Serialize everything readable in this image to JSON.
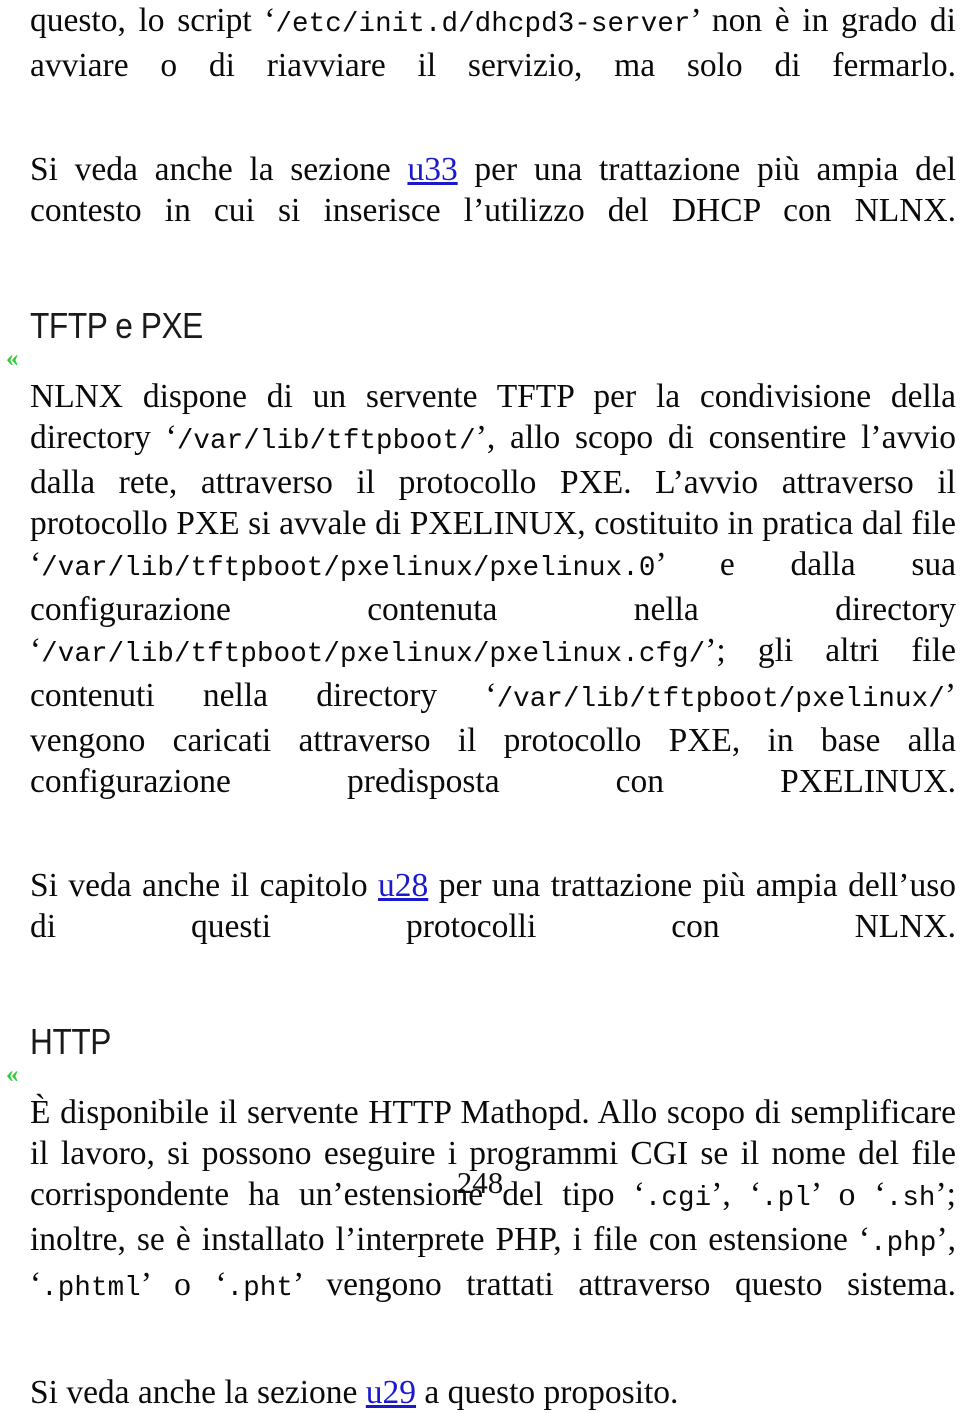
{
  "page": {
    "number": "248",
    "link_color": "#1a1acc",
    "marker_color": "#2ecc33",
    "text_color": "#0a0a0a",
    "background": "#ffffff"
  },
  "paragraphs": {
    "p1": {
      "seg1": "questo, lo script ‘",
      "mono1": "/etc/init.d/dhcpd3-server",
      "seg2": "’ non è in grado di avviare o di riavviare il servizio, ma solo di fermarlo."
    },
    "p2": {
      "seg1": "Si veda anche la sezione ",
      "link": "u33",
      "seg2": " per una trattazione più ampia del contesto in cui si inserisce l’utilizzo del DHCP con NLNX."
    }
  },
  "sections": [
    {
      "id": "tftp-pxe",
      "heading": "TFTP e PXE",
      "marker": "«",
      "body": {
        "seg1": "NLNX dispone di un servente TFTP per la condivisione della directory ‘",
        "mono1": "/var/lib/tftpboot/",
        "seg2": "’, allo scopo di consentire l’avvio dalla rete, attraverso il protocollo PXE. L’avvio attraverso il protocollo PXE si avvale di PXELINUX, costituito in pratica dal file ‘",
        "mono2": "/var/lib/tftpboot/pxelinux/pxelinux.0",
        "seg3": "’ e dalla sua configurazione contenuta nella directory ‘",
        "mono3": "/var/lib/tftpboot/pxelinux/pxelinux.cfg/",
        "seg4": "’; gli altri file contenuti nella directory ‘",
        "mono4": "/var/lib/tftpboot/pxelinux/",
        "seg5": "’ vengono caricati attraverso il protocollo PXE, in base alla configurazione predisposta con PXELINUX."
      },
      "note": {
        "seg1": "Si veda anche il capitolo ",
        "link": "u28",
        "seg2": " per una trattazione più ampia dell’uso di questi protocolli con NLNX."
      }
    },
    {
      "id": "http",
      "heading": "HTTP",
      "marker": "«",
      "body": {
        "seg1": "È disponibile il servente HTTP Mathopd. Allo scopo di semplificare il lavoro, si possono eseguire i programmi CGI se il nome del file corrispondente ha un’estensione del tipo ‘",
        "mono1": ".cgi",
        "seg2": "’, ‘",
        "mono2": ".pl",
        "seg3": "’ o ‘",
        "mono3": ".sh",
        "seg4": "’; inoltre, se è installato l’interprete PHP, i file con estensione ‘",
        "mono4": ".php",
        "seg5": "’, ‘",
        "mono5": ".phtml",
        "seg6": "’ o ‘",
        "mono6": ".pht",
        "seg7": "’ vengono trattati attraverso questo sistema."
      },
      "note": {
        "seg1": "Si veda anche la sezione ",
        "link": "u29",
        "seg2": " a questo proposito."
      }
    }
  ]
}
